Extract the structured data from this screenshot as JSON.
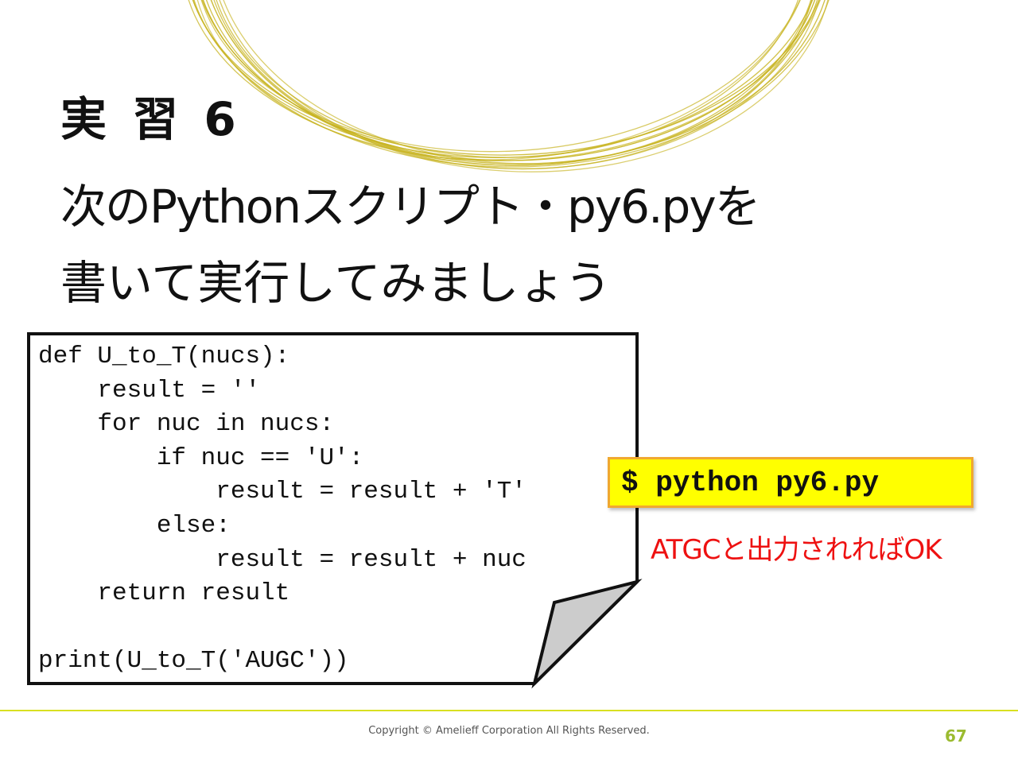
{
  "slide": {
    "title": "実 習 6",
    "instruction_line1": "次のPythonスクリプト・py6.pyを",
    "instruction_line2": "書いて実行してみましょう"
  },
  "code": {
    "lines": [
      "def U_to_T(nucs):",
      "    result = ''",
      "    for nuc in nucs:",
      "        if nuc == 'U':",
      "            result = result + 'T'",
      "        else:",
      "            result = result + nuc",
      "    return result",
      "",
      "print(U_to_T('AUGC'))"
    ]
  },
  "command": {
    "text": "$ python py6.py"
  },
  "note": "ATGCと出力されればOK",
  "footer": {
    "copyright": "Copyright © Amelieff Corporation All Rights Reserved.",
    "page_number": "67"
  },
  "colors": {
    "ring": "#c8b422",
    "command_bg": "#ffff00",
    "command_border": "#f0a830",
    "note": "#ee1111",
    "footer_line": "#d9e021",
    "page_number": "#9bbb30",
    "fold": "#cccccc"
  }
}
